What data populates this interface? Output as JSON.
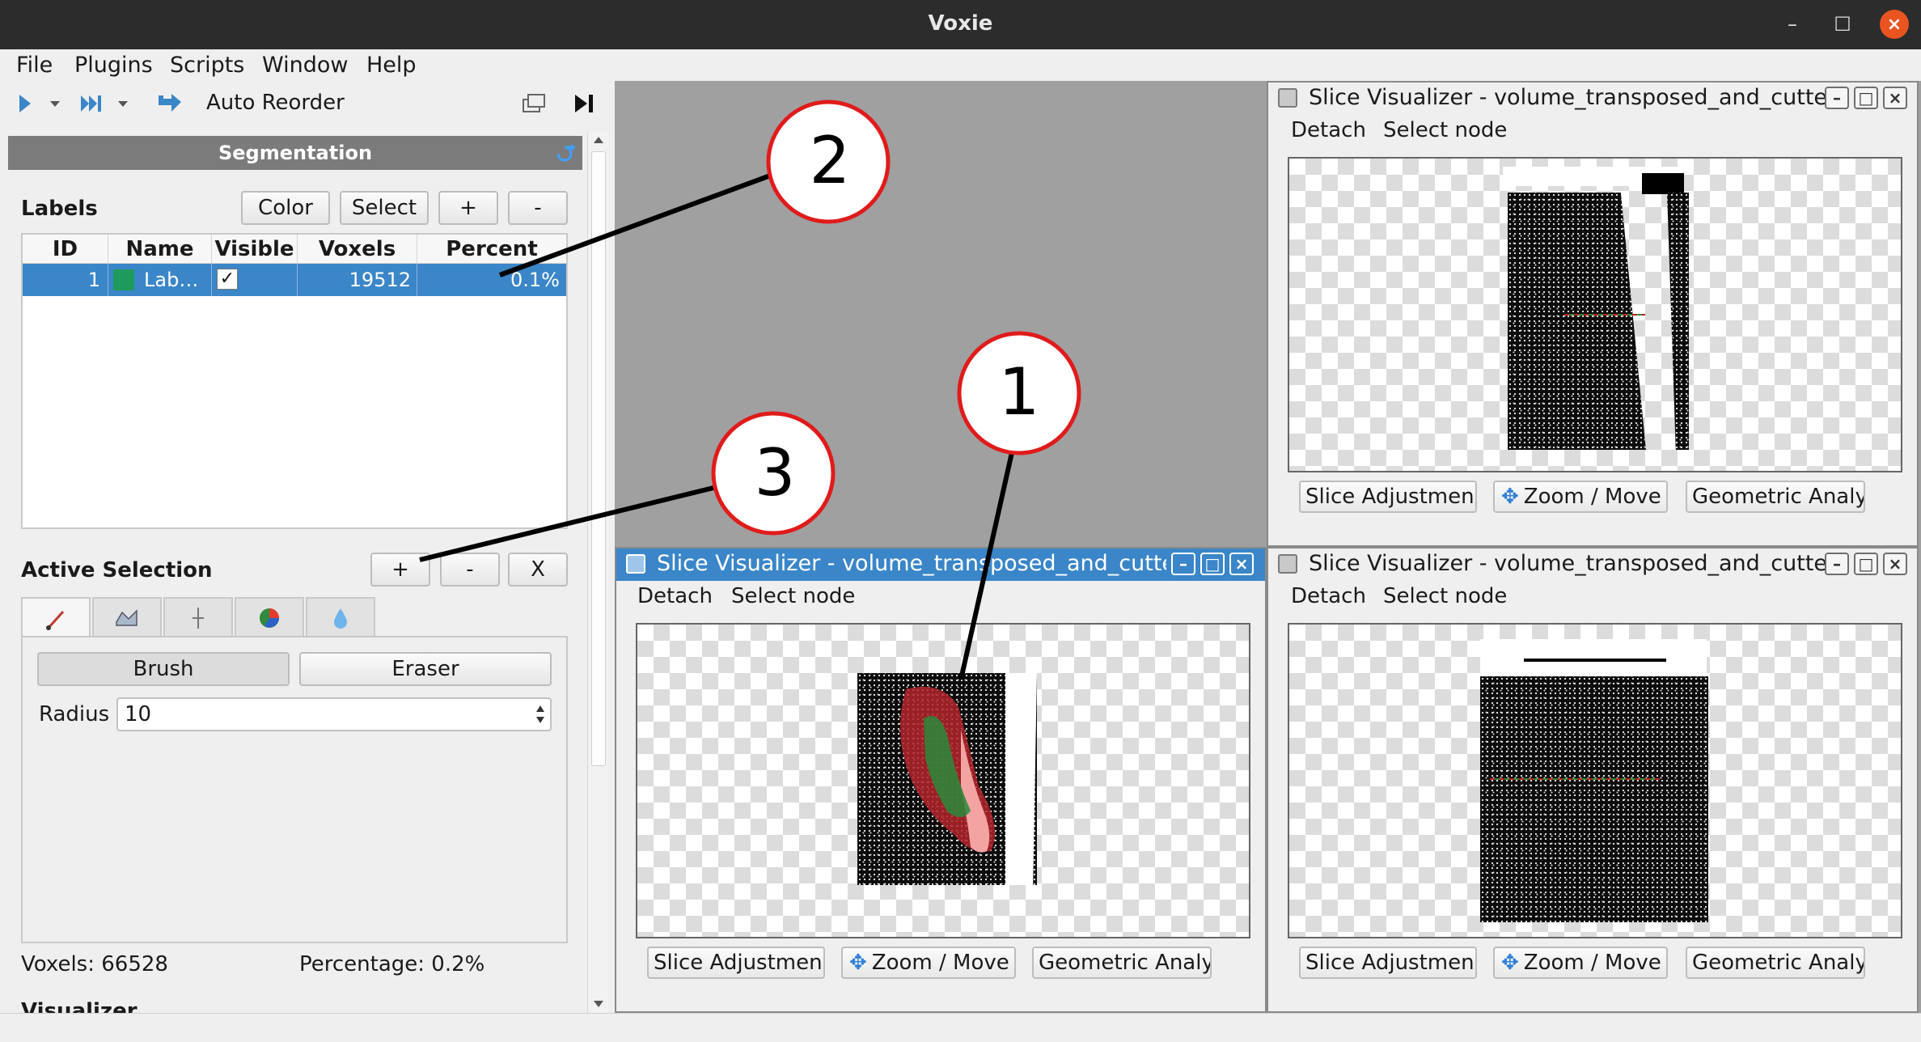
{
  "window": {
    "title": "Voxie"
  },
  "menu": [
    "File",
    "Plugins",
    "Scripts",
    "Window",
    "Help"
  ],
  "toolbar": {
    "auto_reorder": "Auto Reorder"
  },
  "segmentation": {
    "header": "Segmentation",
    "labels_title": "Labels",
    "buttons": {
      "color": "Color",
      "select": "Select",
      "add": "+",
      "remove": "-"
    },
    "columns": [
      "ID",
      "Name",
      "Visible",
      "Voxels",
      "Percent"
    ],
    "rows": [
      {
        "id": "1",
        "name": "Lab…",
        "visible": true,
        "voxels": "19512",
        "percent": "0.1%",
        "color": "#1e9a5c"
      }
    ],
    "active_selection": {
      "title": "Active Selection",
      "buttons": {
        "add": "+",
        "remove": "-",
        "clear": "X"
      },
      "tabs": [
        "brush-tool-icon",
        "lasso-tool-icon",
        "threshold-tool-icon",
        "pie-tool-icon",
        "drop-tool-icon"
      ],
      "brush_label": "Brush",
      "eraser_label": "Eraser",
      "radius_label": "Radius",
      "radius_value": "10"
    },
    "voxels_text": "Voxels: 66528",
    "percentage_text": "Percentage: 0.2%",
    "visualizer_label": "Visualizer"
  },
  "slice_visualizers": [
    {
      "title": "Slice Visualizer - volume_transposed_and_cutte…",
      "detach": "Detach",
      "select_node": "Select node",
      "btn1": "Slice Adjustmen",
      "btn2": "Zoom / Move",
      "btn3": "Geometric Analy:"
    },
    {
      "title": "Slice Visualizer - volume_transposed_and_cutte…",
      "detach": "Detach",
      "select_node": "Select node",
      "btn1": "Slice Adjustmen",
      "btn2": "Zoom / Move",
      "btn3": "Geometric Analy:"
    },
    {
      "title": "Slice Visualizer - volume_transposed_and_cutte…",
      "detach": "Detach",
      "select_node": "Select node",
      "btn1": "Slice Adjustmen",
      "btn2": "Zoom / Move",
      "btn3": "Geometric Analy:"
    }
  ],
  "annotations": [
    "1",
    "2",
    "3"
  ],
  "colors": {
    "accent": "#3a86c8",
    "annotation": "#e01b1b",
    "label_green": "#1e9a5c"
  }
}
